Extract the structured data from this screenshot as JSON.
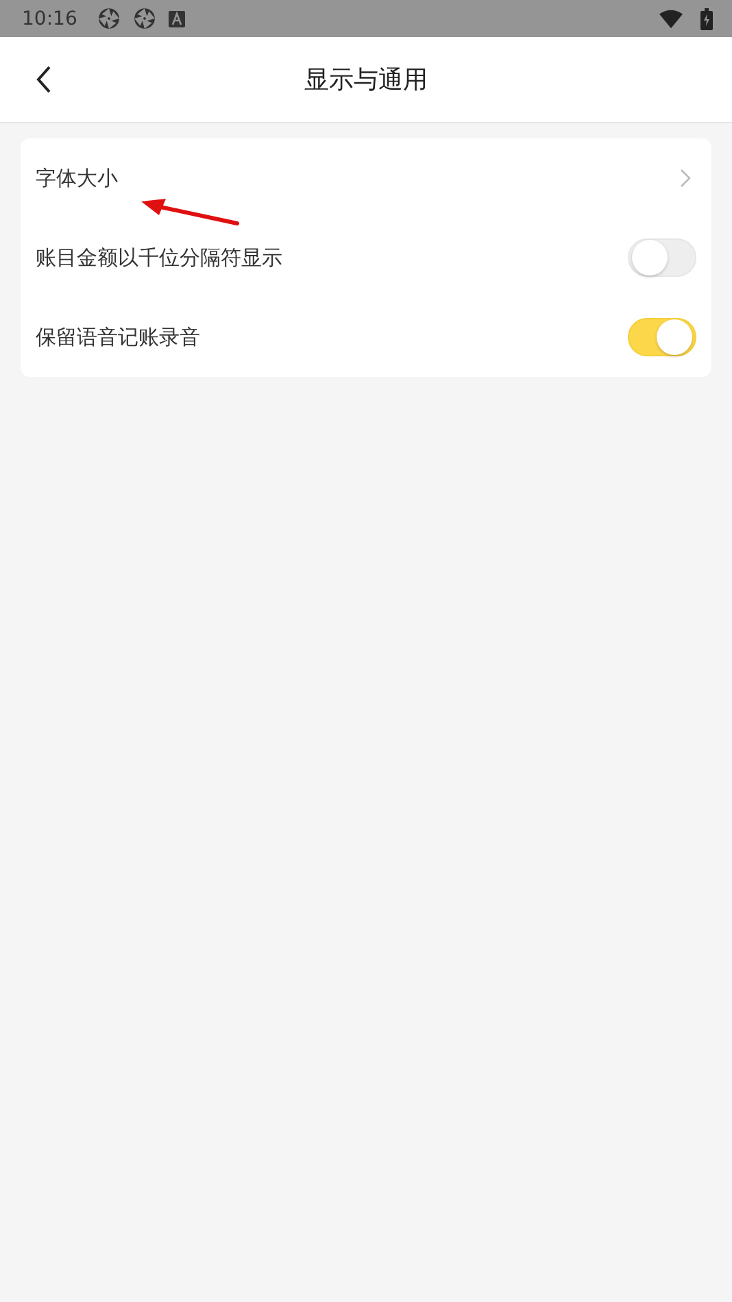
{
  "status_bar": {
    "time": "10:16"
  },
  "header": {
    "title": "显示与通用"
  },
  "settings": [
    {
      "kind": "link",
      "label": "字体大小"
    },
    {
      "kind": "toggle",
      "label": "账目金额以千位分隔符显示",
      "on": false
    },
    {
      "kind": "toggle",
      "label": "保留语音记账录音",
      "on": true
    }
  ]
}
